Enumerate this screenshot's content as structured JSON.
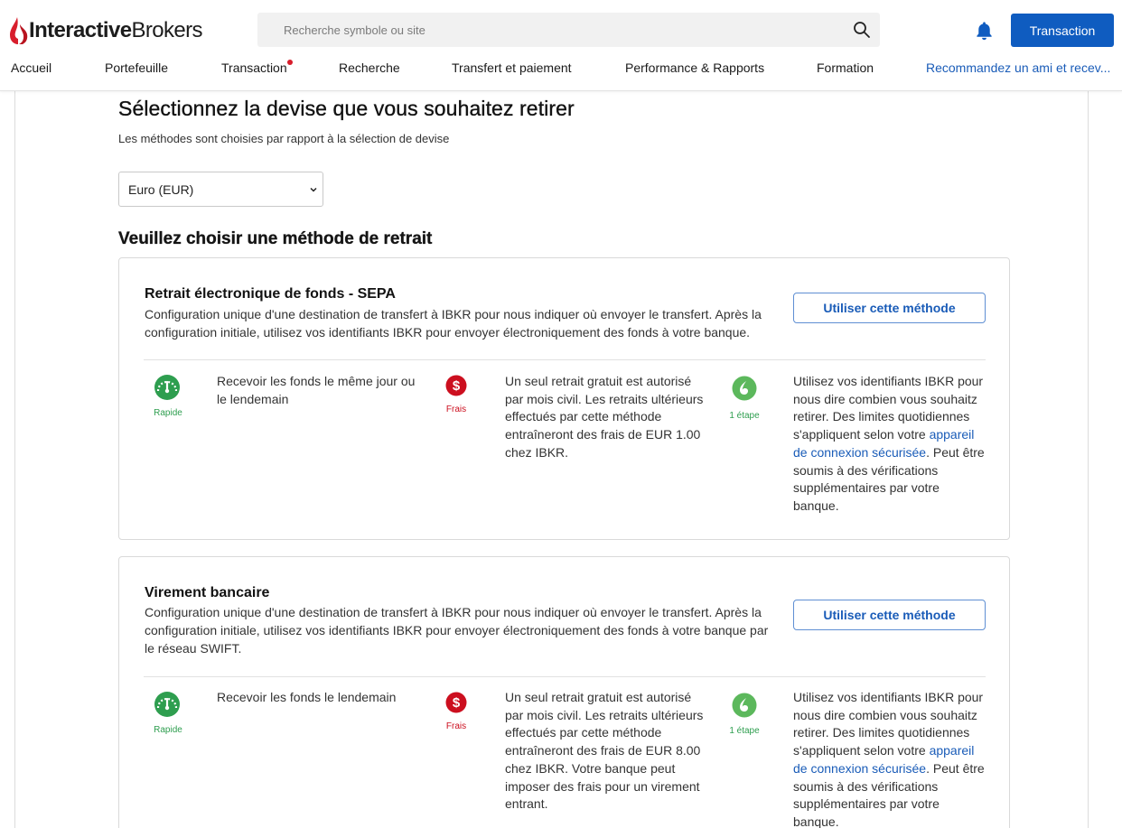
{
  "header": {
    "logo_bold": "Interactive",
    "logo_regular": "Brokers",
    "search_placeholder": "Recherche symbole ou site",
    "transaction_button": "Transaction",
    "nav": [
      {
        "label": "Accueil"
      },
      {
        "label": "Portefeuille"
      },
      {
        "label": "Transaction"
      },
      {
        "label": "Recherche"
      },
      {
        "label": "Transfert et paiement"
      },
      {
        "label": "Performance & Rapports"
      },
      {
        "label": "Formation"
      },
      {
        "label": "Recommandez un ami et recev..."
      }
    ]
  },
  "main": {
    "title": "Sélectionnez la devise que vous souhaitez retirer",
    "subtitle": "Les méthodes sont choisies par rapport à la sélection de devise",
    "currency_selected": "Euro (EUR)",
    "method_heading": "Veuillez choisir une méthode de retrait"
  },
  "methods": [
    {
      "title": "Retrait électronique de fonds - SEPA",
      "description": "Configuration unique d'une destination de transfert à IBKR pour nous indiquer où envoyer le transfert. Après la configuration initiale, utilisez vos identifiants IBKR pour envoyer électroniquement des fonds à votre banque.",
      "button": "Utiliser cette méthode",
      "speed_label": "Rapide",
      "speed_text": "Recevoir les fonds le même jour ou le lendemain",
      "fee_label": "Frais",
      "fee_text": "Un seul retrait gratuit est autorisé par mois civil. Les retraits ultérieurs effectués par cette méthode entraîneront des frais de EUR 1.00 chez IBKR.",
      "steps_label": "1 étape",
      "steps_text_1": "Utilisez vos identifiants IBKR pour nous dire combien vous souhaitz retirer. Des limites quotidiennes s'appliquent selon votre",
      "steps_link": "appareil de connexion sécurisée",
      "steps_text_2": ". Peut être soumis à des vérifications supplémentaires par votre banque."
    },
    {
      "title": "Virement bancaire",
      "description": "Configuration unique d'une destination de transfert à IBKR pour nous indiquer où envoyer le transfert. Après la configuration initiale, utilisez vos identifiants IBKR pour envoyer électroniquement des fonds à votre banque par le réseau SWIFT.",
      "button": "Utiliser cette méthode",
      "speed_label": "Rapide",
      "speed_text": "Recevoir les fonds le lendemain",
      "fee_label": "Frais",
      "fee_text": "Un seul retrait gratuit est autorisé par mois civil. Les retraits ultérieurs effectués par cette méthode entraîneront des frais de EUR 8.00 chez IBKR. Votre banque peut imposer des frais pour un virement entrant.",
      "steps_label": "1 étape",
      "steps_text_1": "Utilisez vos identifiants IBKR pour nous dire combien vous souhaitz retirer. Des limites quotidiennes s'appliquent selon votre",
      "steps_link": "appareil de connexion sécurisée",
      "steps_text_2": ". Peut être soumis à des vérifications supplémentaires par votre banque."
    }
  ],
  "colors": {
    "brand_red": "#d81e2c",
    "primary_blue": "#0f5cc0",
    "link_blue": "#1a5cb8",
    "fast_green": "#2e9e4f",
    "step_green": "#5cb85c",
    "fee_red": "#cc0f1f"
  },
  "icons": {
    "logo": "ib-flame-logo",
    "search": "search-icon",
    "notifications": "bell-icon",
    "dropdown": "chevron-down-icon",
    "speed": "speedometer-icon",
    "fee": "dollar-icon",
    "steps": "step-check-icon"
  }
}
